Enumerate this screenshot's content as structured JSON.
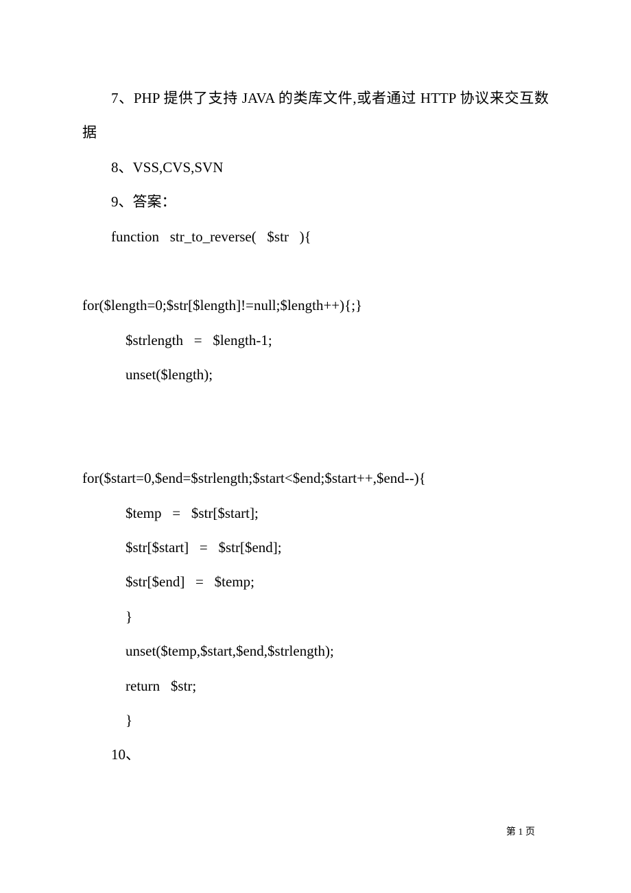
{
  "lines": {
    "l1": "7、PHP 提供了支持 JAVA 的类库文件,或者通过 HTTP 协议来交互数据",
    "l2": "8、VSS,CVS,SVN",
    "l3": "9、答案：",
    "l4": "function   str_to_reverse(   $str   ){",
    "l5": "for($length=0;$str[$length]!=null;$length++){;}",
    "l6": "$strlength   =   $length-1;",
    "l7": "unset($length);",
    "l8": "for($start=0,$end=$strlength;$start<$end;$start++,$end--){",
    "l9": "$temp   =   $str[$start];",
    "l10": "$str[$start]   =   $str[$end];",
    "l11": "$str[$end]   =   $temp;",
    "l12": "}",
    "l13": "unset($temp,$start,$end,$strlength);",
    "l14": "return   $str;",
    "l15": "}",
    "l16": "10、"
  },
  "footer": {
    "page_number": "第 1 页"
  }
}
